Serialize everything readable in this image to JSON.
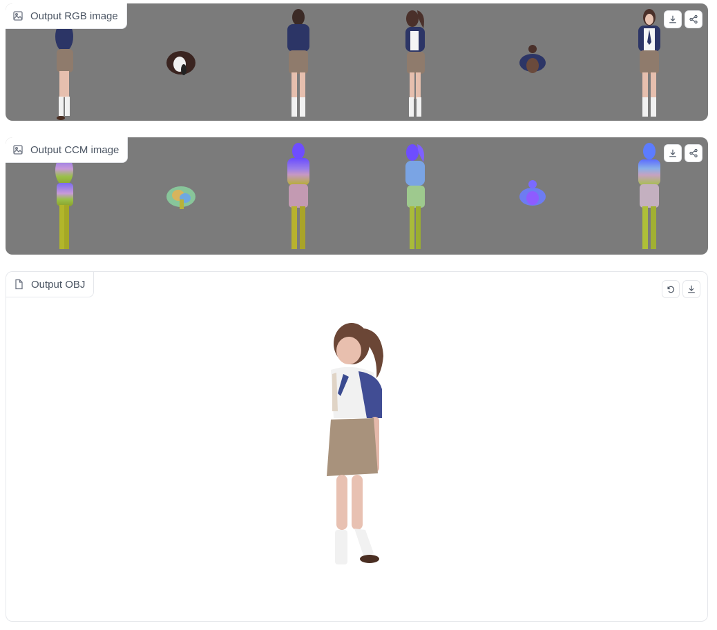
{
  "panels": {
    "rgb": {
      "label": "Output RGB image",
      "icon": "image-icon"
    },
    "ccm": {
      "label": "Output CCM image",
      "icon": "image-icon"
    },
    "obj": {
      "label": "Output OBJ",
      "icon": "file-icon"
    }
  },
  "colors": {
    "image_bg": "#7b7b7b",
    "panel_border": "#e5e7eb",
    "label_text": "#4b5563"
  }
}
